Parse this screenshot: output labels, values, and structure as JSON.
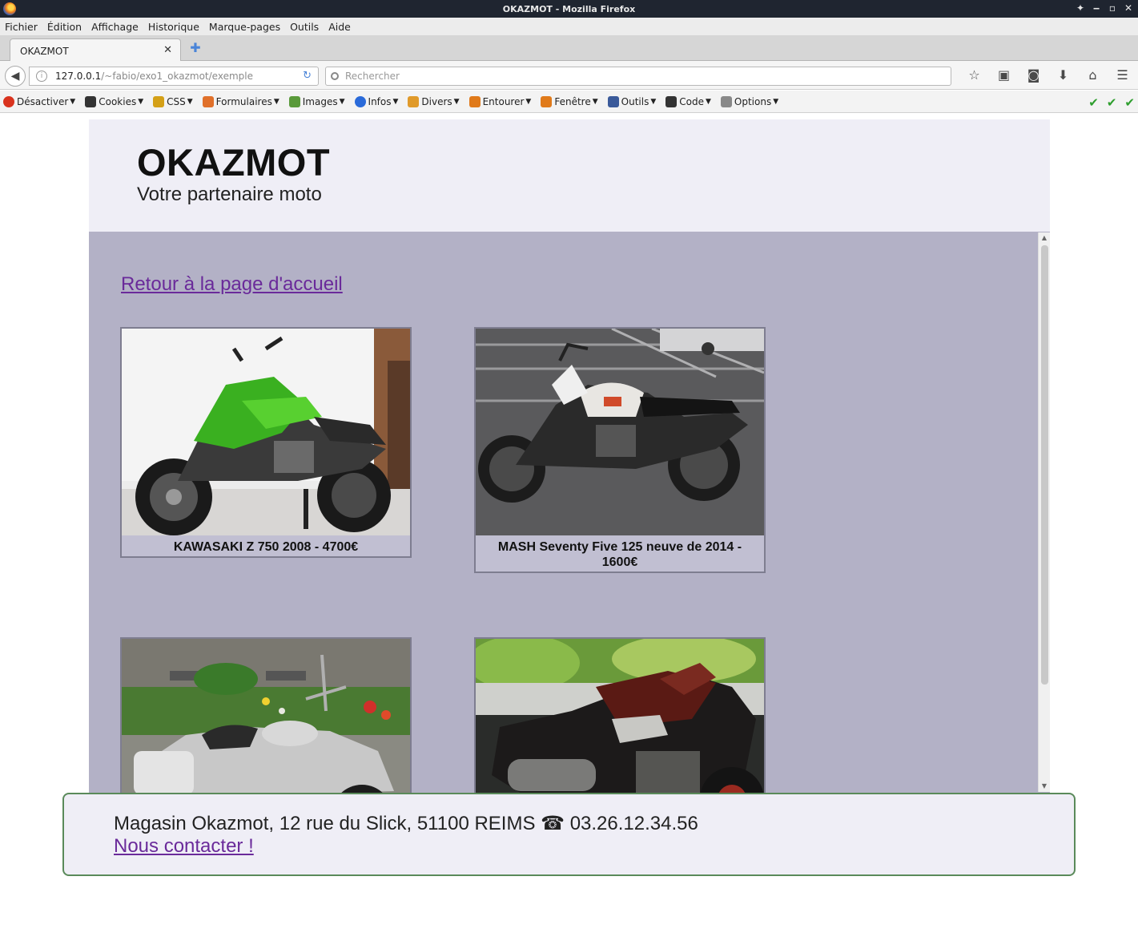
{
  "window": {
    "title": "OKAZMOT - Mozilla Firefox"
  },
  "menubar": [
    "Fichier",
    "Édition",
    "Affichage",
    "Historique",
    "Marque-pages",
    "Outils",
    "Aide"
  ],
  "tab": {
    "title": "OKAZMOT"
  },
  "navbar": {
    "url_host": "127.0.0.1",
    "url_path": "/~fabio/exo1_okazmot/exemple",
    "search_placeholder": "Rechercher"
  },
  "devbar": {
    "items": [
      {
        "label": "Désactiver",
        "icon": "disable-icon",
        "color": "#d9331e"
      },
      {
        "label": "Cookies",
        "icon": "cookie-icon",
        "color": "#333333"
      },
      {
        "label": "CSS",
        "icon": "pencil-icon",
        "color": "#d4a017"
      },
      {
        "label": "Formulaires",
        "icon": "form-icon",
        "color": "#e0702a"
      },
      {
        "label": "Images",
        "icon": "image-icon",
        "color": "#5a9a3a"
      },
      {
        "label": "Infos",
        "icon": "info-icon",
        "color": "#2a6ad9"
      },
      {
        "label": "Divers",
        "icon": "misc-icon",
        "color": "#e09a2a"
      },
      {
        "label": "Entourer",
        "icon": "outline-pencil-icon",
        "color": "#e07a1a"
      },
      {
        "label": "Fenêtre",
        "icon": "resize-pencil-icon",
        "color": "#e07a1a"
      },
      {
        "label": "Outils",
        "icon": "tools-icon",
        "color": "#3a5a9a"
      },
      {
        "label": "Code",
        "icon": "code-icon",
        "color": "#333333"
      },
      {
        "label": "Options",
        "icon": "options-icon",
        "color": "#666666"
      }
    ]
  },
  "site": {
    "title": "OKAZMOT",
    "tagline": "Votre partenaire moto",
    "back_link": "Retour à la page d'accueil",
    "listings": [
      {
        "caption": "KAWASAKI Z 750 2008 - 4700€",
        "photo": "green-kawasaki-motorcycle"
      },
      {
        "caption": "MASH Seventy Five 125 neuve de 2014 - 1600€",
        "photo": "white-mash-motorcycle"
      },
      {
        "caption": "",
        "photo": "silver-cruiser-motorcycle"
      },
      {
        "caption": "",
        "photo": "brown-kawasaki-z1000-motorcycle"
      }
    ],
    "footer_address": "Magasin Okazmot, 12 rue du Slick, 51100 REIMS ☎ 03.26.12.34.56",
    "footer_contact": "Nous contacter !"
  },
  "colors": {
    "header_bg": "#efeef6",
    "main_bg": "#b3b1c6",
    "link": "#6a2a9a",
    "footer_border": "#5a8a5a"
  }
}
